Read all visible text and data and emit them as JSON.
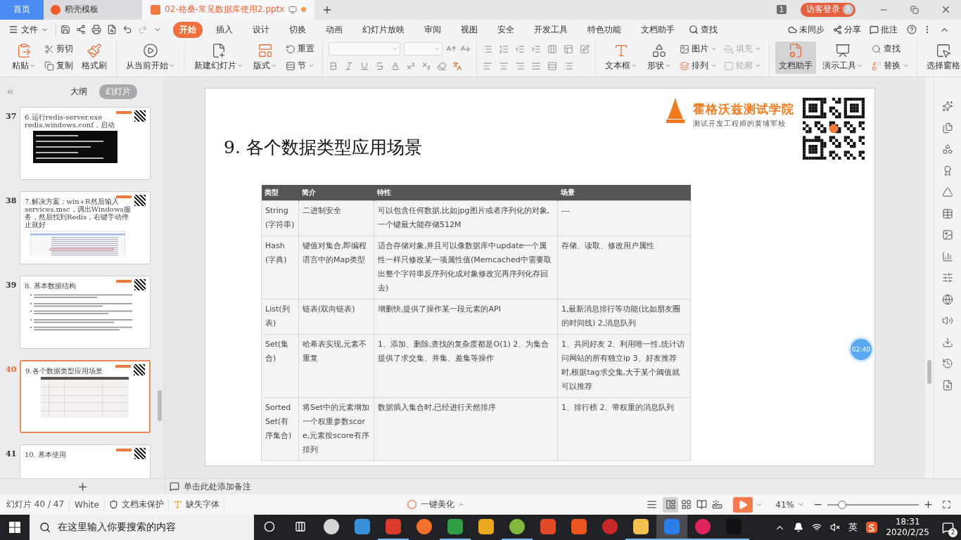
{
  "tab_bar": {
    "tabs": [
      {
        "label": "首页",
        "kind": "home",
        "selected": false,
        "modified": false
      },
      {
        "label": "稻壳模板",
        "kind": "docer",
        "selected": false,
        "modified": false
      },
      {
        "label": "02-格桑-常见数据库使用2.pptx",
        "kind": "file",
        "selected": true,
        "modified": true
      }
    ],
    "window_count": "1",
    "login": "访客登录"
  },
  "menu_bar": {
    "file": "文件",
    "tabs": [
      {
        "label": "开始",
        "selected": true
      },
      {
        "label": "插入",
        "selected": false
      },
      {
        "label": "设计",
        "selected": false
      },
      {
        "label": "切换",
        "selected": false
      },
      {
        "label": "动画",
        "selected": false
      },
      {
        "label": "幻灯片放映",
        "selected": false
      },
      {
        "label": "审阅",
        "selected": false
      },
      {
        "label": "视图",
        "selected": false
      },
      {
        "label": "安全",
        "selected": false
      },
      {
        "label": "开发工具",
        "selected": false
      },
      {
        "label": "特色功能",
        "selected": false
      },
      {
        "label": "文档助手",
        "selected": false
      }
    ],
    "search": "查找",
    "sync": "未同步",
    "share": "分享",
    "comment": "批注"
  },
  "ribbon": [
    {
      "kind": "tools",
      "items": [
        {
          "label": "粘贴",
          "kind": "large",
          "dropdown": true,
          "disabled": false,
          "pressed": false
        },
        {
          "label": "剪切",
          "kind": "small",
          "dropdown": false,
          "disabled": false,
          "pressed": false
        },
        {
          "label": "复制",
          "kind": "small",
          "dropdown": false,
          "disabled": false,
          "pressed": false
        },
        {
          "label": "格式刷",
          "kind": "large",
          "dropdown": false,
          "disabled": false,
          "pressed": false
        }
      ]
    },
    {
      "kind": "tools",
      "items": [
        {
          "label": "从当前开始",
          "kind": "large",
          "dropdown": true,
          "disabled": false,
          "pressed": false
        }
      ]
    },
    {
      "kind": "tools",
      "items": [
        {
          "label": "新建幻灯片",
          "kind": "large",
          "dropdown": true,
          "disabled": false,
          "pressed": false
        },
        {
          "label": "版式",
          "kind": "large",
          "dropdown": true,
          "disabled": false,
          "pressed": false
        },
        {
          "label": "重置",
          "kind": "small",
          "dropdown": false,
          "disabled": false,
          "pressed": false
        },
        {
          "label": "节",
          "kind": "small",
          "dropdown": true,
          "disabled": false,
          "pressed": false
        }
      ]
    },
    {
      "kind": "font"
    },
    {
      "kind": "paragraph"
    },
    {
      "kind": "tools",
      "items": [
        {
          "label": "文本框",
          "kind": "large",
          "dropdown": true,
          "disabled": false,
          "pressed": false
        },
        {
          "label": "形状",
          "kind": "large",
          "dropdown": true,
          "disabled": false,
          "pressed": false
        },
        {
          "label": "图片",
          "kind": "small",
          "dropdown": true,
          "disabled": false,
          "pressed": false
        },
        {
          "label": "排列",
          "kind": "small",
          "dropdown": true,
          "disabled": false,
          "pressed": false
        },
        {
          "label": "填充",
          "kind": "small",
          "dropdown": true,
          "disabled": true,
          "pressed": false
        },
        {
          "label": "轮廓",
          "kind": "small",
          "dropdown": true,
          "disabled": true,
          "pressed": false
        }
      ]
    },
    {
      "kind": "tools",
      "items": [
        {
          "label": "文档助手",
          "kind": "large",
          "dropdown": false,
          "disabled": false,
          "pressed": true
        },
        {
          "label": "演示工具",
          "kind": "large",
          "dropdown": true,
          "disabled": false,
          "pressed": false
        },
        {
          "label": "查找",
          "kind": "small",
          "dropdown": false,
          "disabled": false,
          "pressed": false
        },
        {
          "label": "替换",
          "kind": "small",
          "dropdown": true,
          "disabled": false,
          "pressed": false
        }
      ]
    },
    {
      "kind": "tools",
      "items": [
        {
          "label": "选择窗格",
          "kind": "large",
          "dropdown": false,
          "disabled": false,
          "pressed": false
        }
      ]
    }
  ],
  "slide_panel": {
    "tabs": [
      {
        "label": "大纲",
        "selected": false
      },
      {
        "label": "幻灯片",
        "selected": true
      }
    ],
    "slides": [
      {
        "number": "37",
        "title": "6.运行redis-server.exe redis.windows.conf，启动",
        "kind": "terminal",
        "selected": false
      },
      {
        "number": "38",
        "title": "7.解决方案：win+R然后输入services.msc，调出Windows服务，然后找到Redis，右键手动停止就好",
        "kind": "screenshot",
        "selected": false
      },
      {
        "number": "39",
        "title": "8. 基本数据结构",
        "kind": "bullets",
        "selected": false
      },
      {
        "number": "40",
        "title": "9.各个数据类型应用场景",
        "kind": "table",
        "selected": true
      },
      {
        "number": "41",
        "title": "10. 基本使用",
        "kind": "blank",
        "selected": false
      }
    ]
  },
  "slide": {
    "title": "9. 各个数据类型应用场景",
    "logo": "霍格沃兹测试学院",
    "tagline": "测试开发工程师的黄埔军校",
    "table": {
      "columns": [
        "类型",
        "简介",
        "特性",
        "场景"
      ],
      "rows": [
        [
          "String(字符串)",
          "二进制安全",
          "可以包含任何数据,比如jpg图片或者序列化的对象,一个键最大能存储512M",
          "---"
        ],
        [
          "Hash(字典)",
          "键值对集合,即编程语言中的Map类型",
          "适合存储对象,并且可以像数据库中update一个属性一样只修改某一项属性值(Memcached中需要取出整个字符串反序列化成对象修改完再序列化存回去)",
          "存储、读取、修改用户属性"
        ],
        [
          "List(列表)",
          "链表(双向链表)",
          "增删快,提供了操作某一段元素的API",
          "1,最新消息排行等功能(比如朋友圈的时间线) 2,消息队列"
        ],
        [
          "Set(集合)",
          "哈希表实现,元素不重复",
          "1、添加、删除,查找的复杂度都是O(1) 2、为集合提供了求交集、并集、差集等操作",
          "1、共同好友 2、利用唯一性,统计访问网站的所有独立ip 3、好友推荐时,根据tag求交集,大于某个阈值就可以推荐"
        ],
        [
          "Sorted Set(有序集合)",
          "将Set中的元素增加一个权重参数score,元素按score有序排列",
          "数据插入集合时,已经进行天然排序",
          "1、排行榜 2、带权重的消息队列"
        ]
      ]
    }
  },
  "timer_badge": "02:40",
  "notes": {
    "placeholder": "单击此处添加备注"
  },
  "status_bar": {
    "slide_count": "幻灯片 40 / 47",
    "theme": "White",
    "protection": "文档未保护",
    "missing_fonts": "缺失字体",
    "beautify": "一键美化",
    "views": [
      {
        "selected": true
      },
      {
        "selected": false
      },
      {
        "selected": false
      },
      {
        "selected": false
      }
    ],
    "zoom": {
      "label": "41%",
      "level": 0.16
    }
  },
  "taskbar": {
    "search_placeholder": "在这里输入你要搜索的内容",
    "apps": [
      {
        "color": "#d6d6d6",
        "running": false,
        "selected": false
      },
      {
        "color": "#3a8fd9",
        "running": false,
        "selected": false
      },
      {
        "color": "#d93a2b",
        "running": true,
        "selected": false
      },
      {
        "color": "#f2722c",
        "running": false,
        "selected": false
      },
      {
        "color": "#2f9e44",
        "running": true,
        "selected": false
      },
      {
        "color": "#e8a820",
        "running": false,
        "selected": false
      },
      {
        "color": "#7fb83a",
        "running": true,
        "selected": false
      },
      {
        "color": "#e24a2a",
        "running": false,
        "selected": false
      },
      {
        "color": "#e95420",
        "running": false,
        "selected": false
      },
      {
        "color": "#c62828",
        "running": false,
        "selected": false
      },
      {
        "color": "#f2c14e",
        "running": true,
        "selected": false
      },
      {
        "color": "#2b7de9",
        "running": true,
        "selected": true
      },
      {
        "color": "#e0245e",
        "running": true,
        "selected": false
      },
      {
        "color": "#111111",
        "running": true,
        "selected": false
      }
    ],
    "language": "英",
    "time": "18:31",
    "date": "2020/2/25",
    "notifications": "2"
  }
}
